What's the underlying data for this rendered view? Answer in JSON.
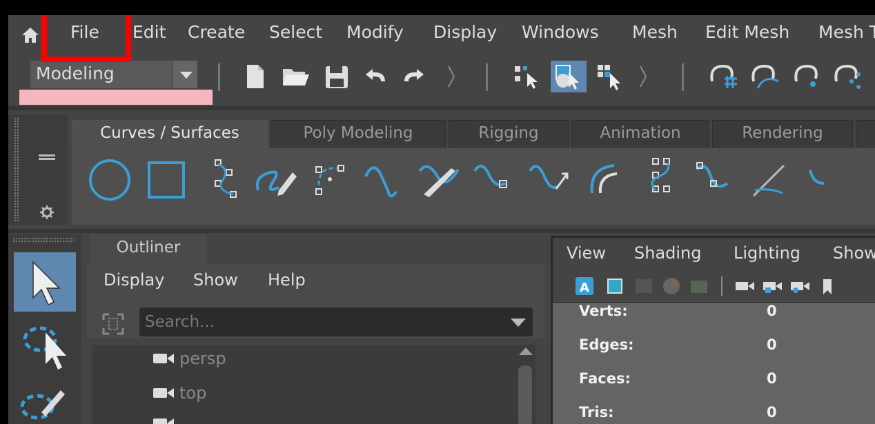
{
  "menubar": {
    "items": [
      "File",
      "Edit",
      "Create",
      "Select",
      "Modify",
      "Display",
      "Windows",
      "Mesh",
      "Edit Mesh",
      "Mesh T"
    ]
  },
  "toolbar": {
    "mode": "Modeling"
  },
  "shelf": {
    "tabs": [
      "Curves / Surfaces",
      "Poly Modeling",
      "Rigging",
      "Animation",
      "Rendering"
    ],
    "active_tab": "Curves / Surfaces"
  },
  "outliner": {
    "tab": "Outliner",
    "menu": [
      "Display",
      "Show",
      "Help"
    ],
    "search_placeholder": "Search...",
    "items": [
      "persp",
      "top"
    ]
  },
  "viewport": {
    "menu": [
      "View",
      "Shading",
      "Lighting",
      "Show"
    ],
    "hud": [
      {
        "label": "Verts:",
        "value": "0"
      },
      {
        "label": "Edges:",
        "value": "0"
      },
      {
        "label": "Faces:",
        "value": "0"
      },
      {
        "label": "Tris:",
        "value": "0"
      }
    ]
  },
  "colors": {
    "accent_blue": "#3b9fd6",
    "highlight_red": "#ff0000",
    "active_tool": "#5e88b0"
  }
}
